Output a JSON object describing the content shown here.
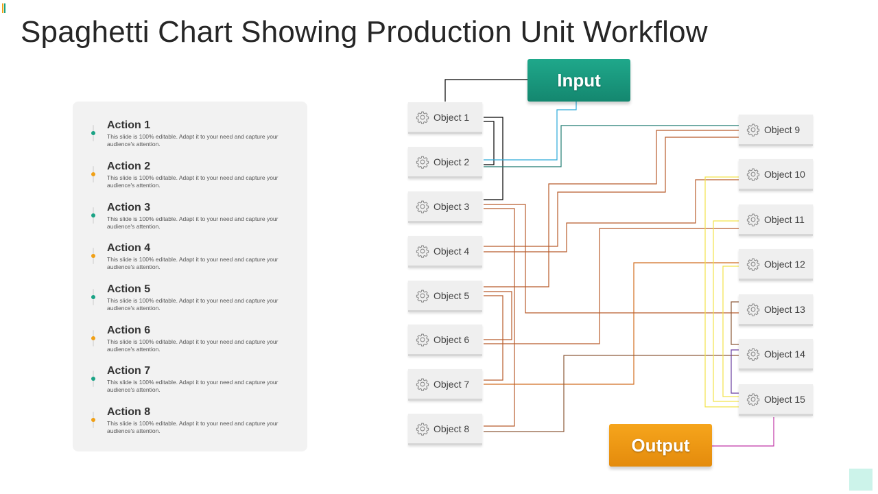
{
  "title": "Spaghetti Chart Showing Production Unit Workflow",
  "colors": {
    "teal": "#1aa385",
    "orange": "#f0a016",
    "wire_black": "#000000",
    "wire_blue": "#2aa9d8",
    "wire_teal": "#1e7b70",
    "wire_rust": "#b85b2a",
    "wire_orange": "#d16e20",
    "wire_yellow": "#f2e34a",
    "wire_brown": "#8d5a3a",
    "wire_purple": "#6a3fa0",
    "wire_magenta": "#c036a6"
  },
  "actions": [
    {
      "title": "Action 1",
      "desc": "This slide is 100% editable. Adapt it to your need and capture your audience's attention.",
      "marker_color": "#1aa385"
    },
    {
      "title": "Action 2",
      "desc": "This slide is 100% editable. Adapt it to your need and capture your audience's attention.",
      "marker_color": "#f0a016"
    },
    {
      "title": "Action 3",
      "desc": "This slide is 100% editable. Adapt it to your need and capture your audience's attention.",
      "marker_color": "#1aa385"
    },
    {
      "title": "Action 4",
      "desc": "This slide is 100% editable. Adapt it to your need and capture your audience's attention.",
      "marker_color": "#f0a016"
    },
    {
      "title": "Action 5",
      "desc": "This slide is 100% editable. Adapt it to your need and capture your audience's attention.",
      "marker_color": "#1aa385"
    },
    {
      "title": "Action 6",
      "desc": "This slide is 100% editable. Adapt it to your need and capture your audience's attention.",
      "marker_color": "#f0a016"
    },
    {
      "title": "Action 7",
      "desc": "This slide is 100% editable. Adapt it to your need and capture your audience's attention.",
      "marker_color": "#1aa385"
    },
    {
      "title": "Action 8",
      "desc": "This slide is 100% editable. Adapt it to your need and capture your audience's attention.",
      "marker_color": "#f0a016"
    }
  ],
  "input": {
    "label": "Input",
    "icon": "none"
  },
  "output": {
    "label": "Output",
    "icon": "none"
  },
  "objects_left": [
    {
      "label": "Object 1",
      "icon": "gear-icon"
    },
    {
      "label": "Object 2",
      "icon": "gear-icon"
    },
    {
      "label": "Object 3",
      "icon": "gear-icon"
    },
    {
      "label": "Object 4",
      "icon": "gear-icon"
    },
    {
      "label": "Object 5",
      "icon": "gear-icon"
    },
    {
      "label": "Object 6",
      "icon": "gear-icon"
    },
    {
      "label": "Object 7",
      "icon": "gear-icon"
    },
    {
      "label": "Object 8",
      "icon": "gear-icon"
    }
  ],
  "objects_right": [
    {
      "label": "Object 9",
      "icon": "gear-icon"
    },
    {
      "label": "Object 10",
      "icon": "gear-icon"
    },
    {
      "label": "Object 11",
      "icon": "gear-icon"
    },
    {
      "label": "Object 12",
      "icon": "gear-icon"
    },
    {
      "label": "Object 13",
      "icon": "gear-icon"
    },
    {
      "label": "Object 14",
      "icon": "gear-icon"
    },
    {
      "label": "Object 15",
      "icon": "gear-icon"
    }
  ]
}
